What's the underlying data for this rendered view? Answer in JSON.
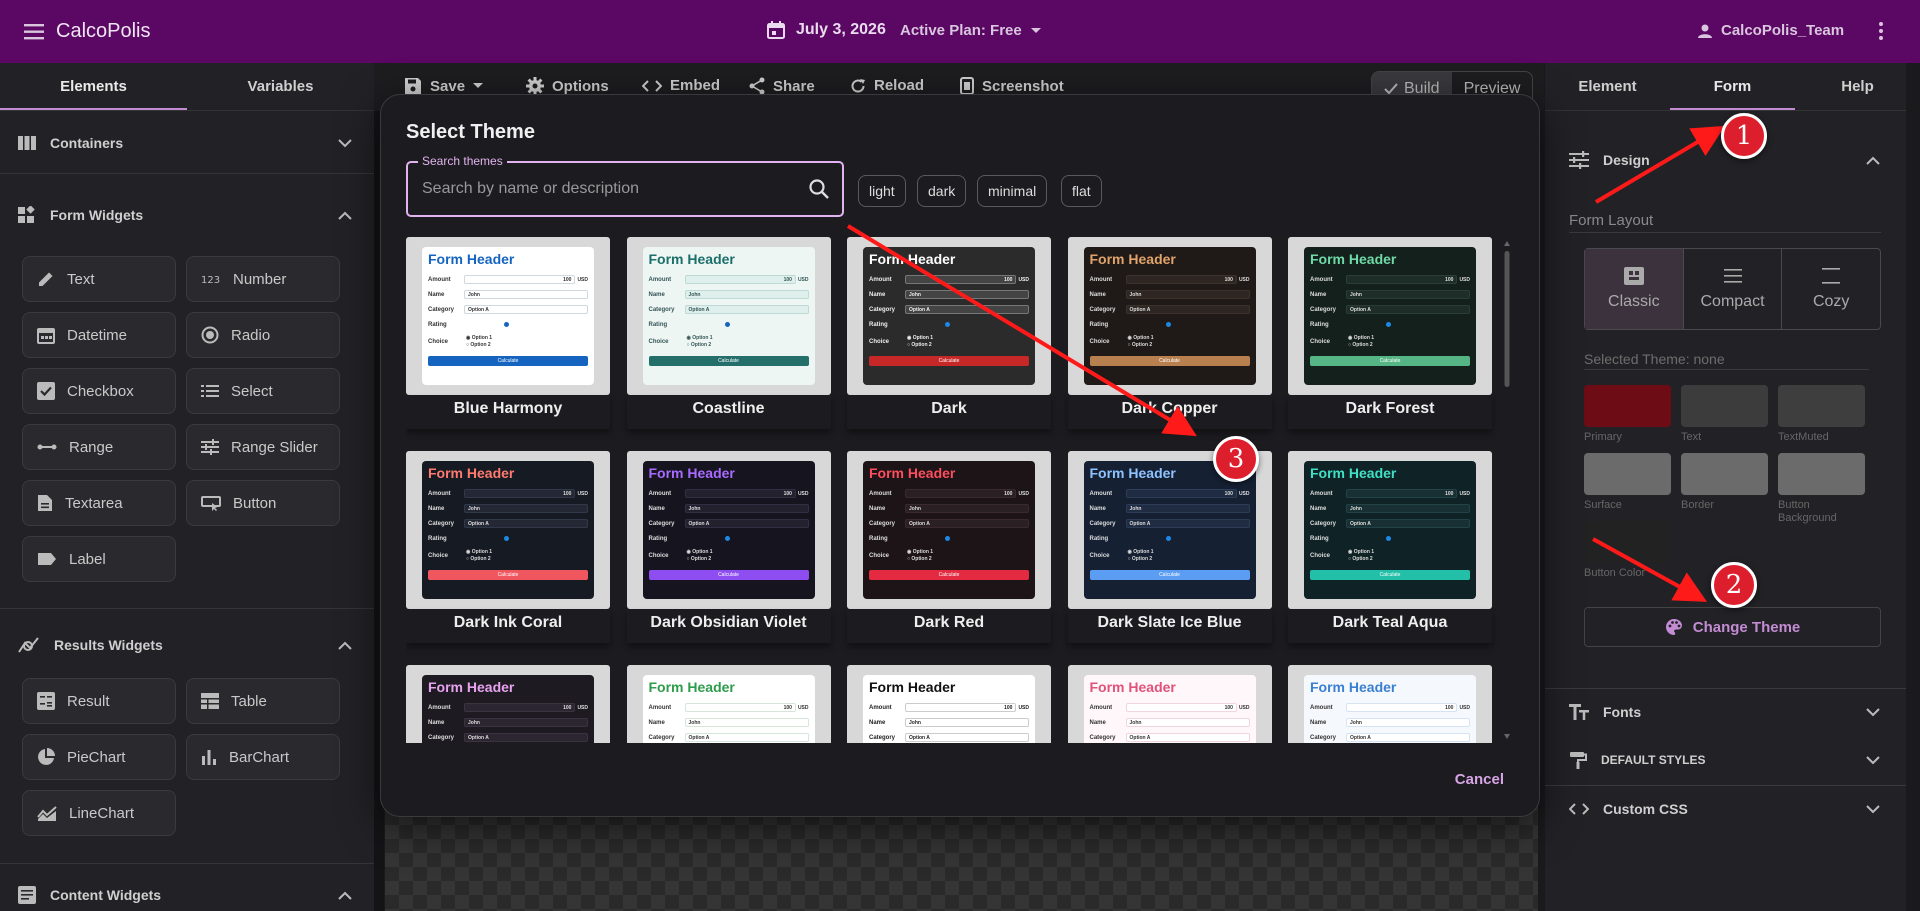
{
  "topbar": {
    "app_title": "CalcoPolis",
    "date": "July 3, 2026",
    "plan": "Active Plan: Free",
    "user": "CalcoPolis_Team"
  },
  "left_panel": {
    "tabs": [
      "Elements",
      "Variables"
    ],
    "sections": {
      "containers": "Containers",
      "form_widgets": "Form Widgets",
      "results_widgets": "Results Widgets",
      "content_widgets": "Content Widgets"
    },
    "form_widgets": [
      "Text",
      "Number",
      "Datetime",
      "Radio",
      "Checkbox",
      "Select",
      "Range",
      "Range Slider",
      "Textarea",
      "Button",
      "Label"
    ],
    "results_widgets": [
      "Result",
      "Table",
      "PieChart",
      "BarChart",
      "LineChart"
    ]
  },
  "toolbar": {
    "save": "Save",
    "options": "Options",
    "embed": "Embed",
    "share": "Share",
    "reload": "Reload",
    "screenshot": "Screenshot",
    "build": "Build",
    "preview": "Preview"
  },
  "right_panel": {
    "tabs": [
      "Element",
      "Form",
      "Help"
    ],
    "design_label": "Design",
    "form_layout_label": "Form Layout",
    "layouts": [
      "Classic",
      "Compact",
      "Cozy"
    ],
    "selected_theme": "Selected Theme: none",
    "swatches": [
      {
        "label": "Primary",
        "color": "#6e0c16"
      },
      {
        "label": "Text",
        "color": "#3c3c3c"
      },
      {
        "label": "TextMuted",
        "color": "#3e3e3e"
      },
      {
        "label": "Surface",
        "color": "#6b6b6b"
      },
      {
        "label": "Border",
        "color": "#6b6b6b"
      },
      {
        "label": "Button Background",
        "color": "#6b6b6b"
      },
      {
        "label": "Button Color",
        "color": "#222222"
      }
    ],
    "change_theme": "Change Theme",
    "fonts": "Fonts",
    "default_styles": "DEFAULT STYLES",
    "custom_css": "Custom CSS"
  },
  "modal": {
    "title": "Select Theme",
    "search_label": "Search themes",
    "search_placeholder": "Search by name or description",
    "chips": [
      "light",
      "dark",
      "minimal",
      "flat"
    ],
    "cancel": "Cancel",
    "preview_text": {
      "header": "Form Header",
      "amount": "Amount",
      "amount_value": "100",
      "usd": "USD",
      "name": "Name",
      "name_value": "John",
      "category": "Category",
      "category_value": "Option A",
      "rating": "Rating",
      "choice": "Choice",
      "option1": "Option 1",
      "option2": "Option 2",
      "calculate": "Calculate"
    },
    "themes": [
      {
        "name": "Blue Harmony",
        "bg": "#ffffff",
        "header": "#1565c0",
        "text": "#333333",
        "field": "#ffffff",
        "border": "#cfd8dc",
        "btn": "#1565c0",
        "btn_text": "#ffffff",
        "dot": "#1565c0"
      },
      {
        "name": "Coastline",
        "bg": "#eef6f4",
        "header": "#1b6f6a",
        "text": "#355",
        "field": "#dff0ec",
        "border": "#bfdad4",
        "btn": "#256f6b",
        "btn_text": "#ffffff",
        "dot": "#1565c0"
      },
      {
        "name": "Dark",
        "bg": "#2b2b2b",
        "header": "#ffffff",
        "text": "#eeeeee",
        "field": "#444444",
        "border": "#777777",
        "btn": "#c62828",
        "btn_text": "#ffffff",
        "dot": "#1e88e5"
      },
      {
        "name": "Dark Copper",
        "bg": "#1f1a17",
        "header": "#e0a36a",
        "text": "#dddddd",
        "field": "#2d2622",
        "border": "#3b322c",
        "btn": "#b8804f",
        "btn_text": "#ffffff",
        "dot": "#1e88e5"
      },
      {
        "name": "Dark Forest",
        "bg": "#14201b",
        "header": "#6fd9a8",
        "text": "#dddddd",
        "field": "#1e2d27",
        "border": "#2c3d35",
        "btn": "#56b584",
        "btn_text": "#ffffff",
        "dot": "#1e88e5"
      },
      {
        "name": "Dark Ink Coral",
        "bg": "#161a22",
        "header": "#ff7a70",
        "text": "#dddddd",
        "field": "#232834",
        "border": "#30384a",
        "btn": "#f0565e",
        "btn_text": "#ffffff",
        "dot": "#1e88e5"
      },
      {
        "name": "Dark Obsidian Violet",
        "bg": "#16141f",
        "header": "#a86bff",
        "text": "#dddddd",
        "field": "#24212f",
        "border": "#332e44",
        "btn": "#8e4df0",
        "btn_text": "#ffffff",
        "dot": "#1e88e5"
      },
      {
        "name": "Dark Red",
        "bg": "#1c1416",
        "header": "#ff4d5e",
        "text": "#dddddd",
        "field": "#2a1f22",
        "border": "#3a2a2e",
        "btn": "#e32a40",
        "btn_text": "#ffffff",
        "dot": "#1e88e5"
      },
      {
        "name": "Dark Slate Ice Blue",
        "bg": "#152033",
        "header": "#8ec3ff",
        "text": "#dddddd",
        "field": "#1f2c42",
        "border": "#2e3d57",
        "btn": "#5a9df2",
        "btn_text": "#ffffff",
        "dot": "#1e88e5"
      },
      {
        "name": "Dark Teal Aqua",
        "bg": "#0f2225",
        "header": "#3fe0c5",
        "text": "#dddddd",
        "field": "#183034",
        "border": "#234247",
        "btn": "#22bfa9",
        "btn_text": "#ffffff",
        "dot": "#1e88e5"
      },
      {
        "name": "",
        "bg": "#1e1a22",
        "header": "#e7a3f0",
        "text": "#dddddd",
        "field": "#2b2630",
        "border": "#3a3340",
        "btn": "#b46ac4",
        "btn_text": "#ffffff",
        "dot": "#1e88e5"
      },
      {
        "name": "",
        "bg": "#ffffff",
        "header": "#2e9d4b",
        "text": "#333333",
        "field": "#ffffff",
        "border": "#d6e5da",
        "btn": "#2e9d4b",
        "btn_text": "#ffffff",
        "dot": "#1565c0"
      },
      {
        "name": "",
        "bg": "#ffffff",
        "header": "#111111",
        "text": "#222222",
        "field": "#ffffff",
        "border": "#cccccc",
        "btn": "#111111",
        "btn_text": "#ffffff",
        "dot": "#1565c0"
      },
      {
        "name": "",
        "bg": "#fff7fa",
        "header": "#e0527a",
        "text": "#333333",
        "field": "#ffffff",
        "border": "#f2d5de",
        "btn": "#e0527a",
        "btn_text": "#ffffff",
        "dot": "#1565c0"
      },
      {
        "name": "",
        "bg": "#f5f9fd",
        "header": "#3b7fd0",
        "text": "#333333",
        "field": "#ffffff",
        "border": "#d5e3f3",
        "btn": "#3b7fd0",
        "btn_text": "#ffffff",
        "dot": "#1565c0"
      }
    ]
  },
  "annotations": [
    "1",
    "2",
    "3"
  ],
  "colors": {
    "topbar": "#5b0764",
    "accent": "#c38bd3",
    "annotation_red": "#ff1a1a"
  }
}
